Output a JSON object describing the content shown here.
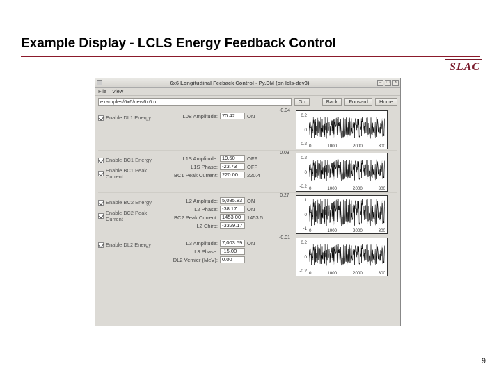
{
  "slide": {
    "title": "Example Display - LCLS Energy Feedback Control",
    "slac_logo": "SLAC",
    "page_number": "9"
  },
  "window": {
    "title": "6x6 Longitudinal Feeback Control - Py.DM (on lcls-dev3)",
    "min_glyph": "–",
    "max_glyph": "□",
    "close_glyph": "×",
    "menu": {
      "file": "File",
      "view": "View"
    },
    "nav": {
      "path": "examples/6x6/new6x6.ui",
      "go": "Go",
      "back": "Back",
      "forward": "Forward",
      "home": "Home"
    },
    "sections": [
      {
        "checks": [
          {
            "label": "Enable DL1 Energy"
          }
        ],
        "params": [
          {
            "label": "L0B Amplitude:",
            "value": "70.42",
            "status": "ON"
          }
        ],
        "mid_val": "-0.04",
        "plot": {
          "yticks": [
            "0.2",
            "0",
            "-0.2"
          ],
          "xticks": [
            "0",
            "1000",
            "2000",
            "300"
          ]
        }
      },
      {
        "checks": [
          {
            "label": "Enable BC1 Energy"
          },
          {
            "label": "Enable BC1 Peak Current"
          }
        ],
        "params": [
          {
            "label": "L1S Amplitude:",
            "value": "19.50",
            "status": "OFF"
          },
          {
            "label": "L1S Phase:",
            "value": "-23.73",
            "status": "OFF"
          },
          {
            "label": "BC1 Peak Current:",
            "value": "220.00",
            "status": "220.4"
          }
        ],
        "mid_val": "0.03",
        "plot": {
          "yticks": [
            "0.2",
            "0",
            "-0.2"
          ],
          "xticks": [
            "0",
            "1000",
            "2000",
            "300"
          ]
        }
      },
      {
        "checks": [
          {
            "label": "Enable BC2 Energy"
          },
          {
            "label": "Enable BC2 Peak Current"
          }
        ],
        "params": [
          {
            "label": "L2 Amplitude:",
            "value": "5,085.83",
            "status": "ON"
          },
          {
            "label": "L2 Phase:",
            "value": "-38.17",
            "status": "ON"
          },
          {
            "label": "BC2 Peak Current:",
            "value": "1453.00",
            "status": "1453.5"
          },
          {
            "label": "L2 Chirp:",
            "value": "-3329.17",
            "status": ""
          }
        ],
        "mid_val": "0.27",
        "plot": {
          "yticks": [
            "1",
            "0",
            "-1"
          ],
          "xticks": [
            "0",
            "1000",
            "2000",
            "300"
          ]
        }
      },
      {
        "checks": [
          {
            "label": "Enable DL2 Energy"
          }
        ],
        "params": [
          {
            "label": "L3 Amplitude:",
            "value": "7,003.59",
            "status": "ON"
          },
          {
            "label": "L3 Phase:",
            "value": "-15.00",
            "status": ""
          },
          {
            "label": "DL2 Vernier (MeV):",
            "value": "0.00",
            "status": ""
          }
        ],
        "mid_val": "-0.01",
        "plot": {
          "yticks": [
            "0.2",
            "0",
            "-0.2"
          ],
          "xticks": [
            "0",
            "1000",
            "2000",
            "300"
          ]
        }
      }
    ]
  }
}
